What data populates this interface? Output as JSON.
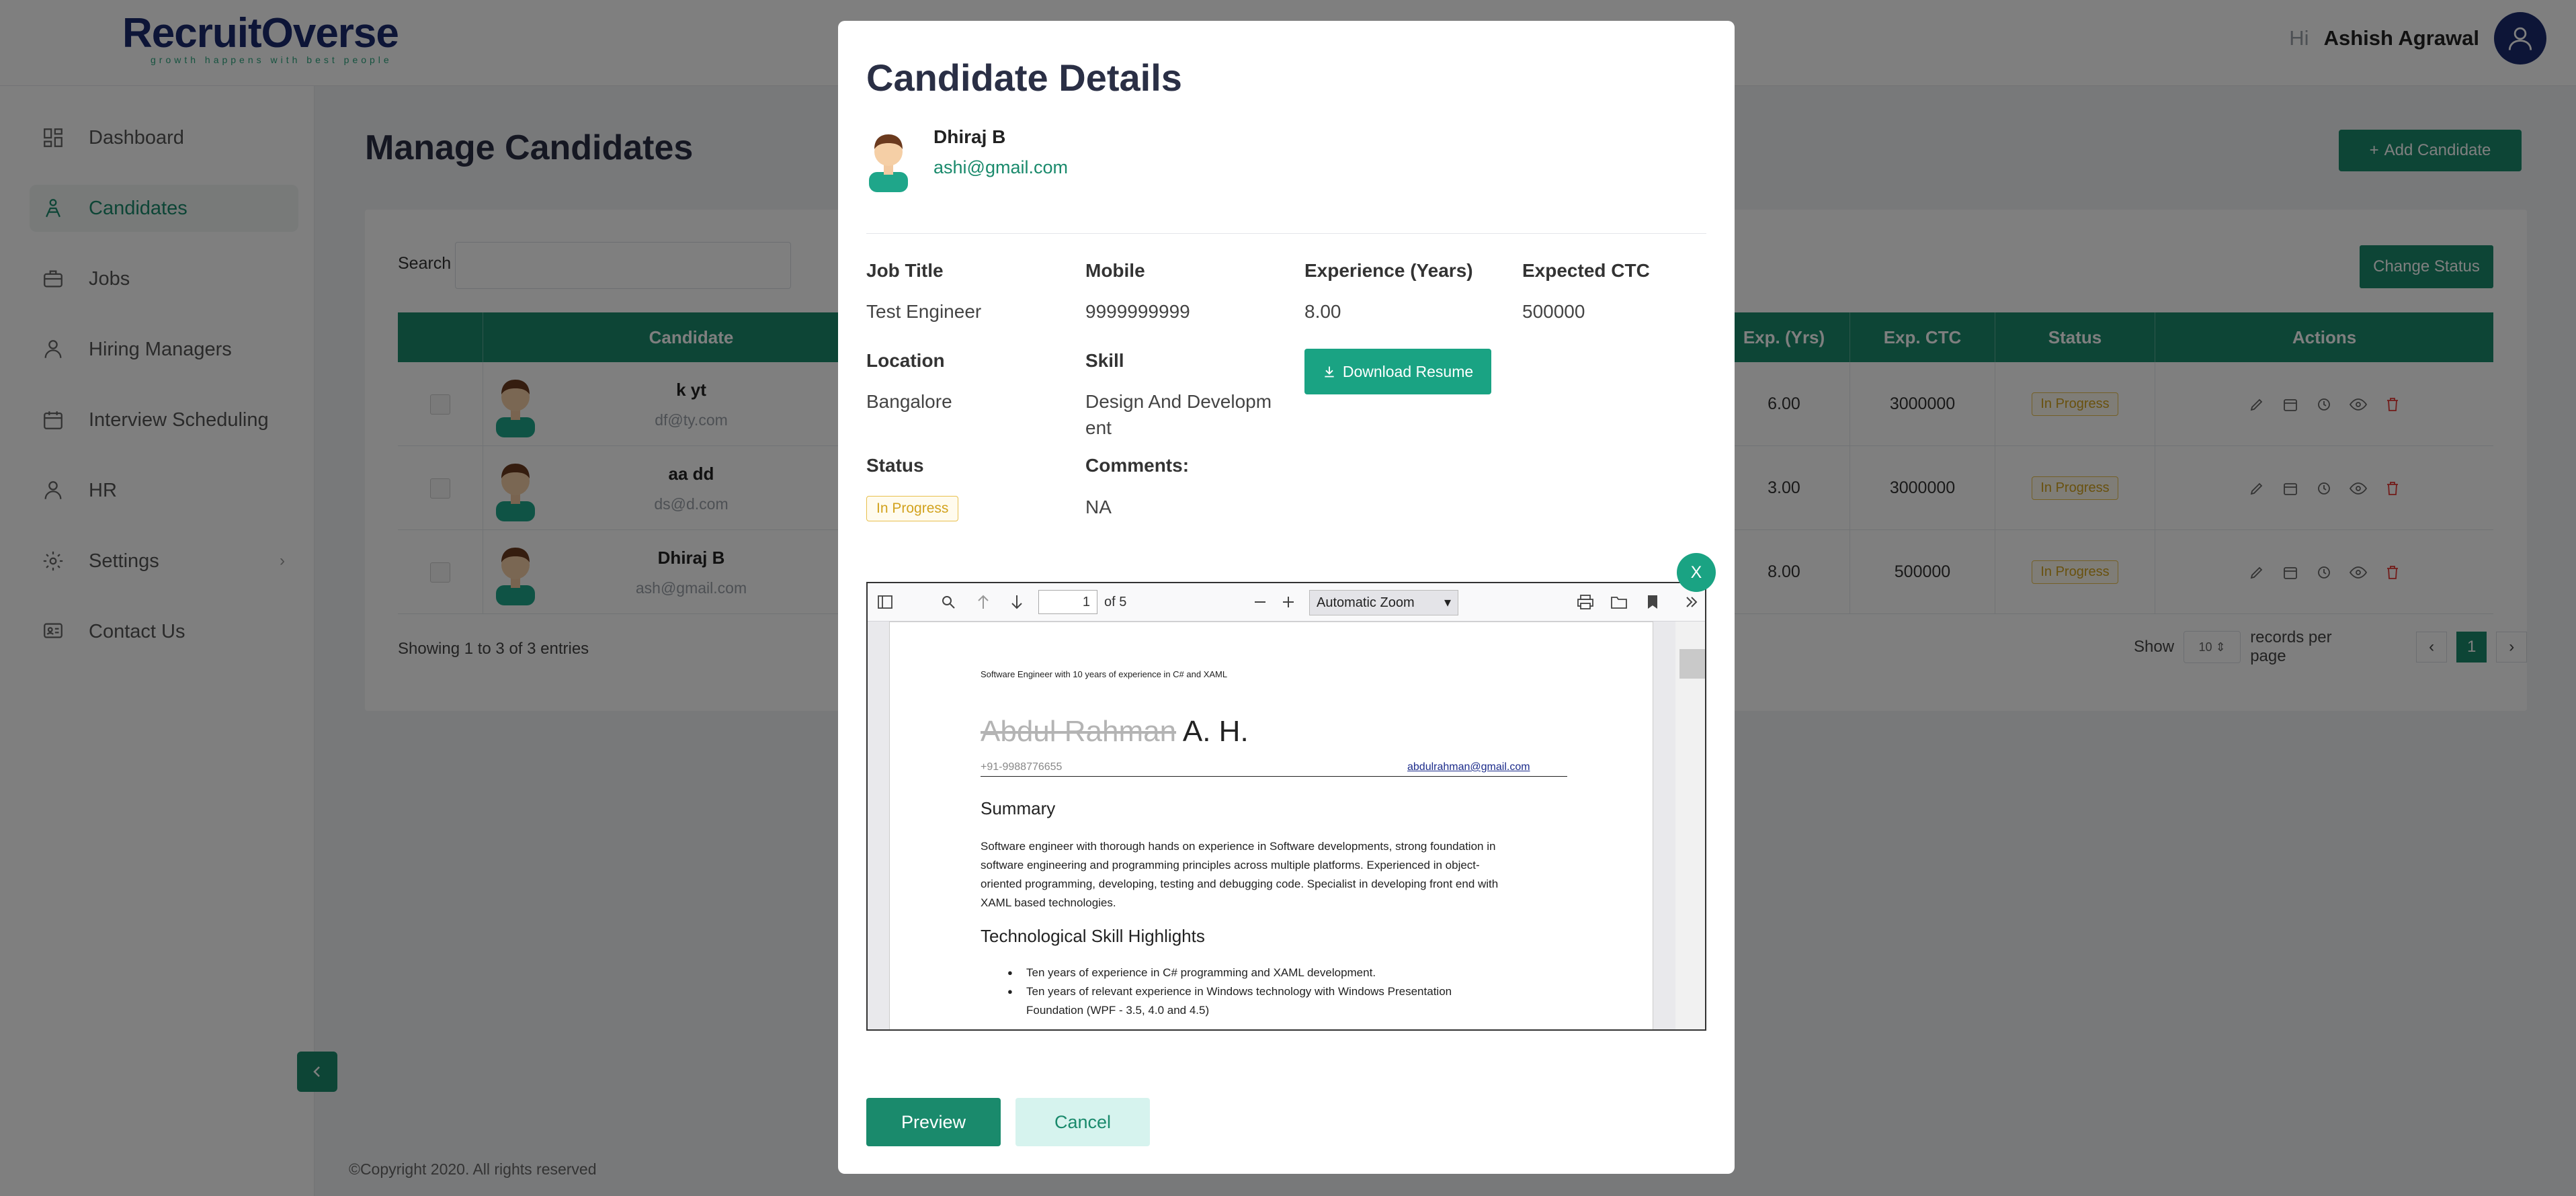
{
  "app": {
    "logo": "RecruitOverse",
    "tagline": "growth happens with best people",
    "greeting": "Hi",
    "user_name": "Ashish Agrawal"
  },
  "sidebar": {
    "items": [
      {
        "label": "Dashboard",
        "icon": "dashboard-icon"
      },
      {
        "label": "Candidates",
        "icon": "candidates-icon",
        "active": true
      },
      {
        "label": "Jobs",
        "icon": "briefcase-icon"
      },
      {
        "label": "Hiring Managers",
        "icon": "person-icon"
      },
      {
        "label": "Interview Scheduling",
        "icon": "calendar-icon"
      },
      {
        "label": "HR",
        "icon": "person-icon"
      },
      {
        "label": "Settings",
        "icon": "gear-icon"
      },
      {
        "label": "Contact Us",
        "icon": "contact-icon"
      }
    ]
  },
  "main": {
    "title": "Manage Candidates",
    "add_button": "Add Candidate",
    "search_label": "Search",
    "change_status_button": "Change Status",
    "columns": [
      "Candidate",
      "Exp. (Yrs)",
      "Exp. CTC",
      "Status",
      "Actions"
    ],
    "rows": [
      {
        "name": "k yt",
        "email": "df@ty.com",
        "exp": "6.00",
        "ctc": "3000000",
        "status": "In Progress"
      },
      {
        "name": "aa dd",
        "email": "ds@d.com",
        "exp": "3.00",
        "ctc": "3000000",
        "status": "In Progress"
      },
      {
        "name": "Dhiraj B",
        "email": "ash@gmail.com",
        "exp": "8.00",
        "ctc": "500000",
        "status": "In Progress"
      }
    ],
    "showing": "Showing 1 to 3 of 3 entries",
    "show_label": "Show",
    "per_page_value": "10",
    "records_label": "records per page",
    "current_page": "1"
  },
  "footer": "©Copyright 2020. All rights reserved",
  "modal": {
    "title": "Candidate Details",
    "name": "Dhiraj B",
    "email": "ashi@gmail.com",
    "fields": {
      "job_title_label": "Job Title",
      "job_title": "Test Engineer",
      "mobile_label": "Mobile",
      "mobile": "9999999999",
      "experience_label": "Experience (Years)",
      "experience": "8.00",
      "ctc_label": "Expected CTC",
      "ctc": "500000",
      "location_label": "Location",
      "location": "Bangalore",
      "skill_label": "Skill",
      "skill_line1": "Design And Developm",
      "skill_line2": "ent",
      "status_label": "Status",
      "status": "In Progress",
      "comments_label": "Comments:",
      "comments": "NA"
    },
    "download_button": "Download Resume",
    "close_label": "X",
    "preview_button": "Preview",
    "cancel_button": "Cancel",
    "viewer": {
      "page_number": "1",
      "page_count": "of 5",
      "zoom": "Automatic Zoom",
      "doc": {
        "headline": "Software Engineer with 10 years of experience in C# and XAML",
        "name_hidden": "Abdul Rahman",
        "name_visible": "A. H.",
        "phone": "+91-9988776655",
        "email": "abdulrahman@gmail.com",
        "summary_heading": "Summary",
        "summary_lines": [
          "Software engineer with thorough hands on experience in Software developments, strong foundation in",
          "software engineering and programming principles across multiple platforms. Experienced in object-",
          "oriented programming, developing, testing and debugging code. Specialist in developing front end with",
          "XAML based technologies."
        ],
        "skills_heading": "Technological Skill Highlights",
        "bullets": [
          "Ten years of experience in C# programming and XAML development.",
          "Ten years of relevant experience in Windows technology with Windows Presentation",
          "Foundation (WPF - 3.5, 4.0 and 4.5)"
        ]
      }
    }
  }
}
